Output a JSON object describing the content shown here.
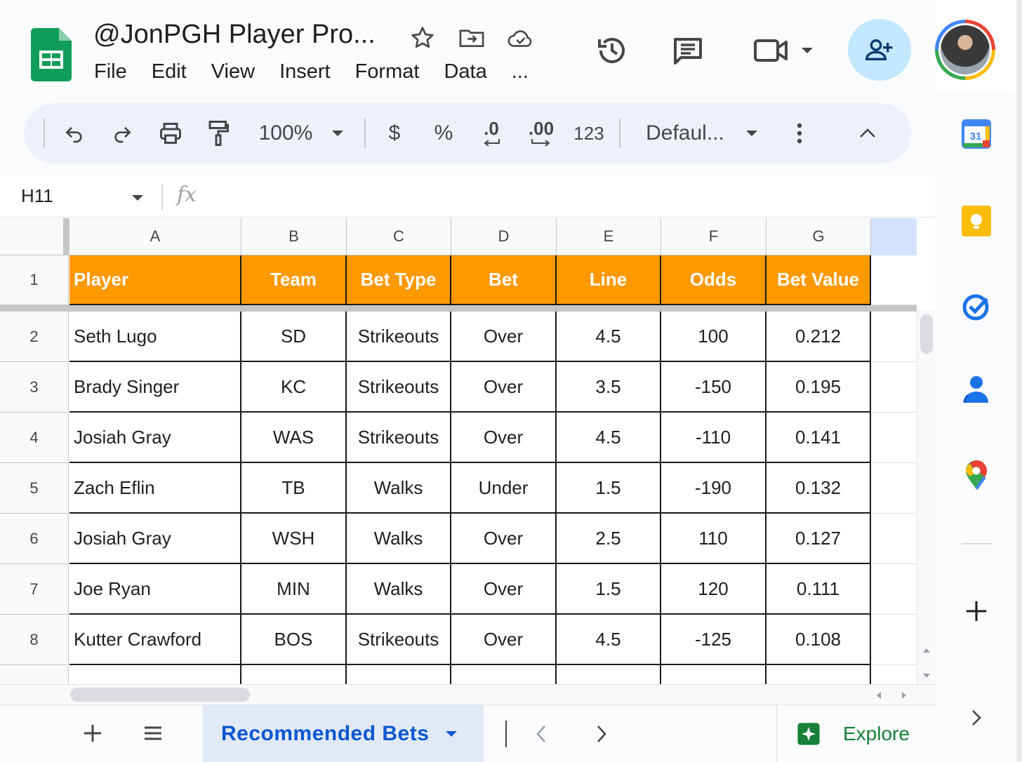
{
  "document": {
    "title": "@JonPGH Player Pro...",
    "menus": [
      "File",
      "Edit",
      "View",
      "Insert",
      "Format",
      "Data",
      "..."
    ]
  },
  "toolbar": {
    "zoom": "100%",
    "currency": "$",
    "percent": "%",
    "decrease_decimal": ".0",
    "increase_decimal": ".00",
    "number_format": "123",
    "font": "Defaul..."
  },
  "formula_bar": {
    "name_box": "H11",
    "fx_label": "fx",
    "value": ""
  },
  "grid": {
    "columns": [
      "A",
      "B",
      "C",
      "D",
      "E",
      "F",
      "G"
    ],
    "header_row_number": "1",
    "headers": [
      "Player",
      "Team",
      "Bet Type",
      "Bet",
      "Line",
      "Odds",
      "Bet Value"
    ],
    "rows": [
      {
        "num": "2",
        "cells": [
          "Seth Lugo",
          "SD",
          "Strikeouts",
          "Over",
          "4.5",
          "100",
          "0.212"
        ]
      },
      {
        "num": "3",
        "cells": [
          "Brady Singer",
          "KC",
          "Strikeouts",
          "Over",
          "3.5",
          "-150",
          "0.195"
        ]
      },
      {
        "num": "4",
        "cells": [
          "Josiah Gray",
          "WAS",
          "Strikeouts",
          "Over",
          "4.5",
          "-110",
          "0.141"
        ]
      },
      {
        "num": "5",
        "cells": [
          "Zach Eflin",
          "TB",
          "Walks",
          "Under",
          "1.5",
          "-190",
          "0.132"
        ]
      },
      {
        "num": "6",
        "cells": [
          "Josiah Gray",
          "WSH",
          "Walks",
          "Over",
          "2.5",
          "110",
          "0.127"
        ]
      },
      {
        "num": "7",
        "cells": [
          "Joe Ryan",
          "MIN",
          "Walks",
          "Over",
          "1.5",
          "120",
          "0.111"
        ]
      },
      {
        "num": "8",
        "cells": [
          "Kutter Crawford",
          "BOS",
          "Strikeouts",
          "Over",
          "4.5",
          "-125",
          "0.108"
        ]
      }
    ],
    "header_color": "#ff9900"
  },
  "sheet_tabs": {
    "active": "Recommended Bets",
    "explore_label": "Explore"
  },
  "colors": {
    "accent": "#0b57d0",
    "share_button": "#c2e7ff",
    "sheets_green": "#0f9d58"
  },
  "side_panel": {
    "calendar_day": "31"
  }
}
